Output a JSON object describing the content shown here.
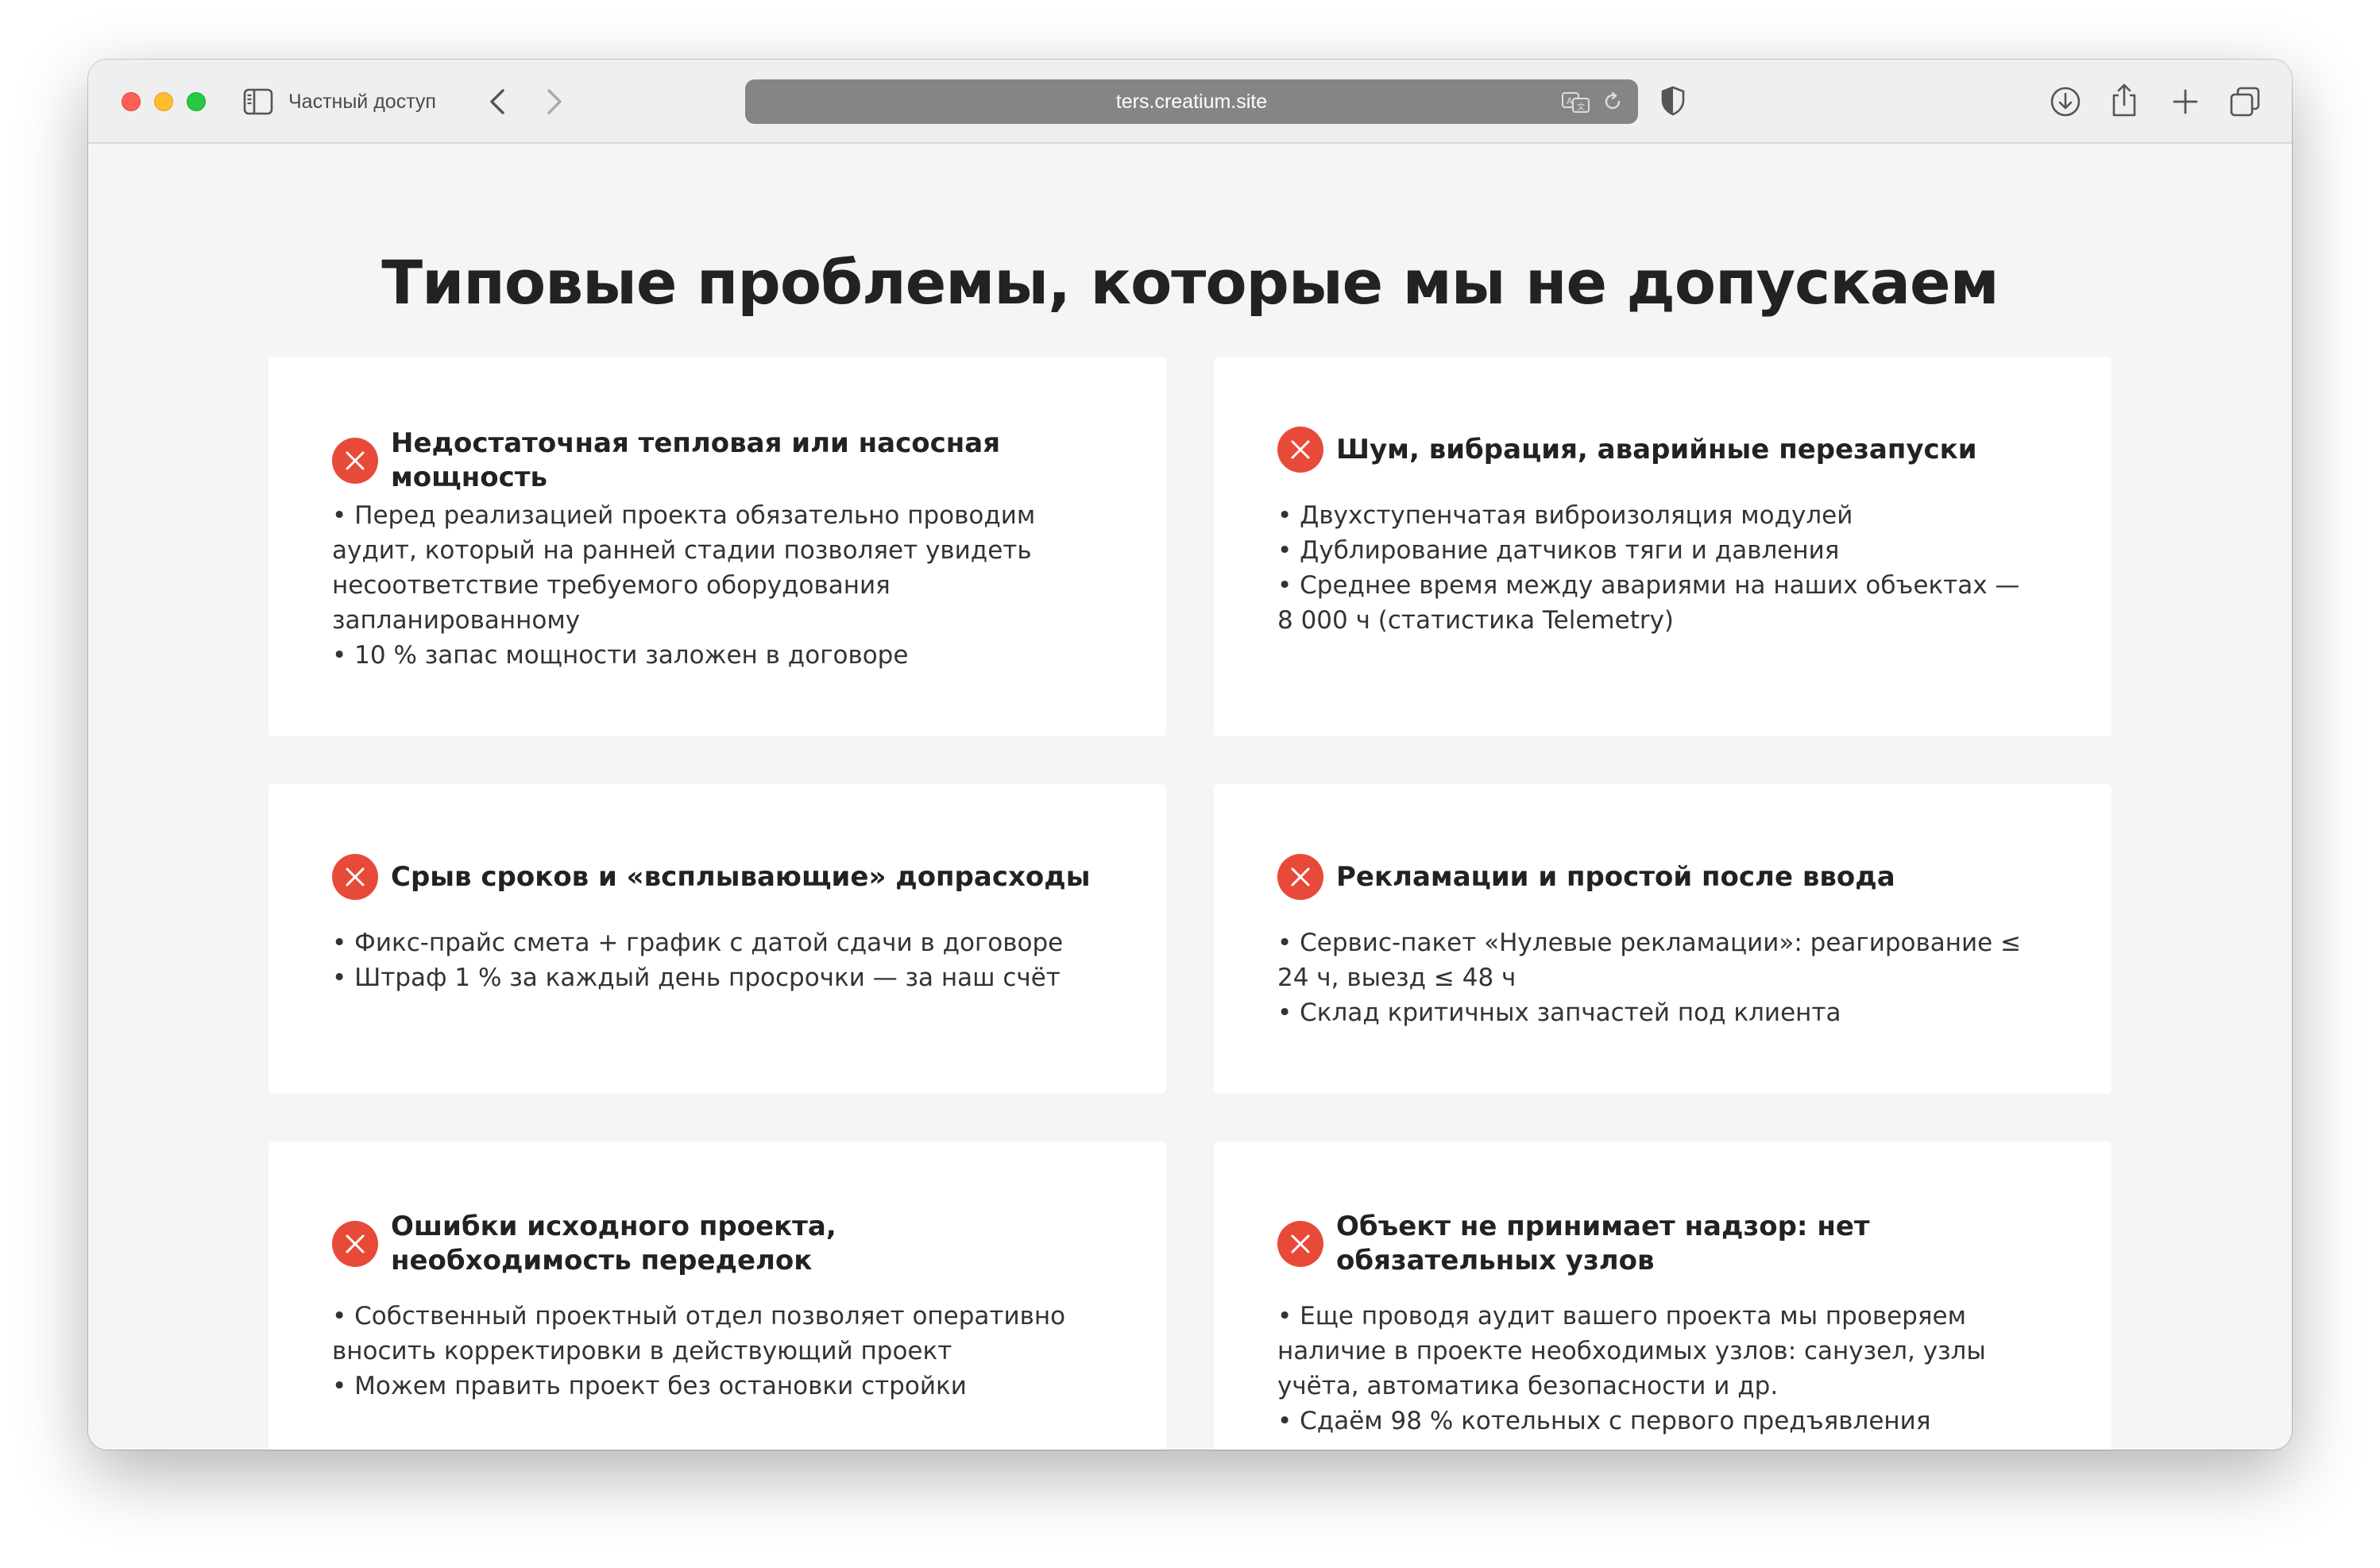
{
  "browser": {
    "private_label": "Частный доступ",
    "url": "ters.creatium.site",
    "traffic_lights": [
      "#ff5f57",
      "#febc2e",
      "#28c840"
    ],
    "icons": [
      "sidebar-icon",
      "chevron-left-icon",
      "chevron-right-icon",
      "translate-icon",
      "reload-icon",
      "shield-icon",
      "download-icon",
      "share-icon",
      "plus-icon",
      "tabs-icon"
    ]
  },
  "page": {
    "title": "Типовые проблемы, которые мы не допускаем",
    "accent_color": "#e84a3a",
    "cards": [
      {
        "title": "Недостаточная тепловая или насосная мощность",
        "lines": [
          "• Перед реализацией проекта обязательно проводим аудит, который на ранней стадии позволяет увидеть несоответствие требуемого оборудования запланированному",
          "• 10 % запас мощности заложен в договоре"
        ]
      },
      {
        "title": "Шум, вибрация, аварийные перезапуски",
        "lines": [
          "• Двухступенчатая виброизоляция модулей",
          "• Дублирование датчиков тяги и давления",
          "• Среднее время между авариями на наших объектах — 8 000 ч (статистика Telemetry)"
        ]
      },
      {
        "title": "Срыв сроков и «всплывающие» допрасходы",
        "lines": [
          "• Фикс-прайс смета + график с датой сдачи в договоре",
          "• Штраф 1 % за каждый день просрочки — за наш счёт"
        ]
      },
      {
        "title": "Рекламации и простой после ввода",
        "lines": [
          "• Сервис-пакет «Нулевые рекламации»: реагирование ≤ 24 ч, выезд ≤ 48 ч",
          "• Склад критичных запчастей под клиента"
        ]
      },
      {
        "title": "Ошибки исходного проекта, необходимость переделок",
        "lines": [
          "• Собственный проектный отдел позволяет оперативно вносить корректировки в действующий проект",
          "• Можем править проект без остановки стройки"
        ]
      },
      {
        "title": "Объект не принимает надзор: нет обязательных узлов",
        "lines": [
          "• Еще проводя аудит вашего проекта мы проверяем наличие в проекте необходимых узлов: санузел, узлы учёта, автоматика безопасности и др.",
          "• Сдаём 98 % котельных с первого предъявления"
        ]
      }
    ]
  }
}
